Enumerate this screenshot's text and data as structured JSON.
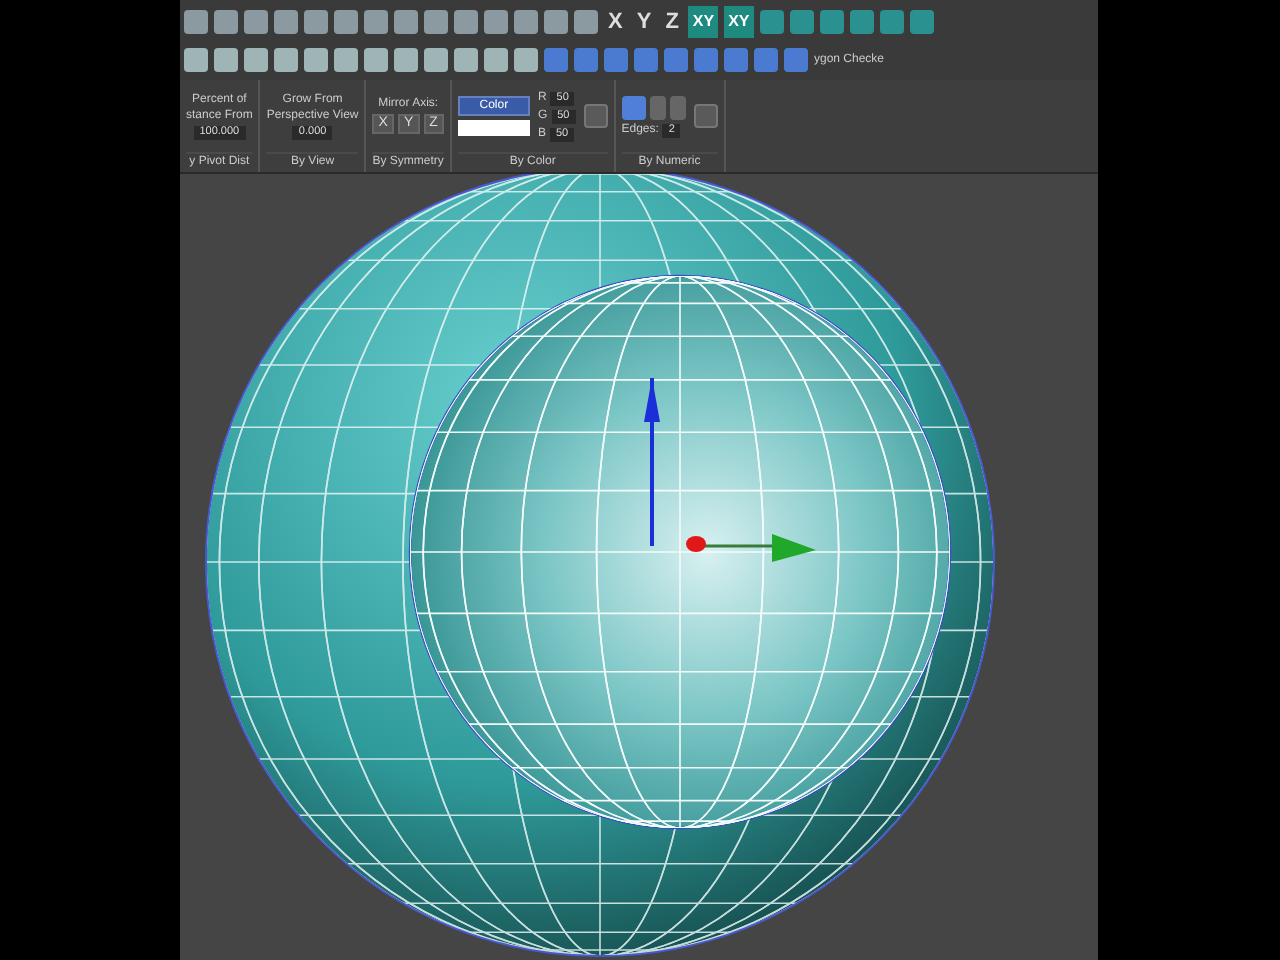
{
  "toolbar": {
    "axis_buttons": [
      {
        "label": "X",
        "selected": false
      },
      {
        "label": "Y",
        "selected": false
      },
      {
        "label": "Z",
        "selected": false
      },
      {
        "label": "XY",
        "selected": true
      },
      {
        "label": "XY",
        "selected": true
      }
    ],
    "plugin_label": "ygon Checke"
  },
  "ribbon": {
    "panels": [
      {
        "kind": "spinner",
        "lines": [
          "Percent of",
          "stance From"
        ],
        "value": "100.000",
        "footer": "y Pivot Dist"
      },
      {
        "kind": "spinner",
        "lines": [
          "Grow From",
          "Perspective View"
        ],
        "value": "0.000",
        "footer": "By View"
      },
      {
        "kind": "axes",
        "lines": [
          "Mirror Axis:"
        ],
        "buttons": [
          "X",
          "Y",
          "Z"
        ],
        "footer": "By Symmetry"
      },
      {
        "kind": "color",
        "button": "Color",
        "channels": [
          {
            "label": "R",
            "value": "50"
          },
          {
            "label": "G",
            "value": "50"
          },
          {
            "label": "B",
            "value": "50"
          }
        ],
        "footer": "By Color"
      },
      {
        "kind": "numeric",
        "label": "Edges:",
        "value": "2",
        "footer": "By Numeric"
      }
    ]
  }
}
